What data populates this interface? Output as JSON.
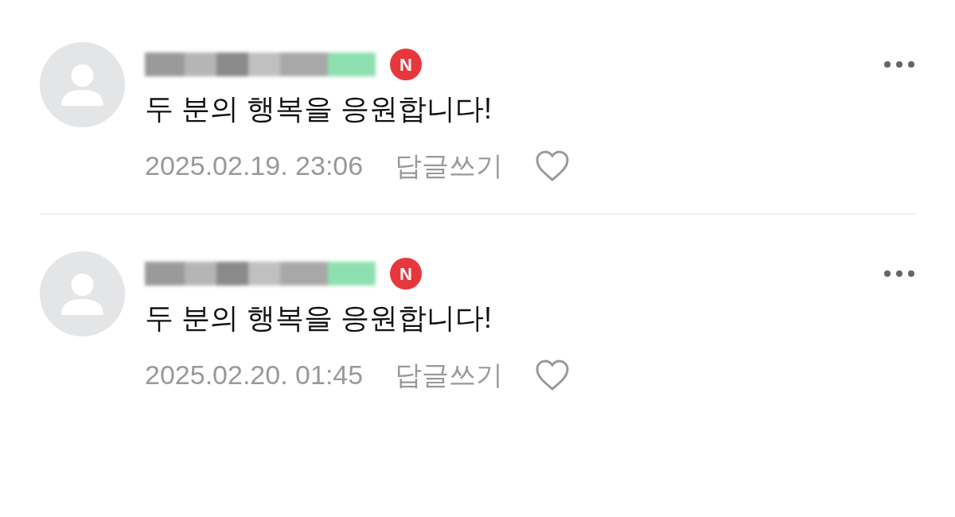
{
  "comments": [
    {
      "badge": "N",
      "text": "두 분의 행복을 응원합니다!",
      "date": "2025.02.19. 23:06",
      "reply": "답글쓰기",
      "liked": false
    },
    {
      "badge": "N",
      "text": "두 분의 행복을 응원합니다!",
      "date": "2025.02.20. 01:45",
      "reply": "답글쓰기",
      "liked": false
    }
  ]
}
